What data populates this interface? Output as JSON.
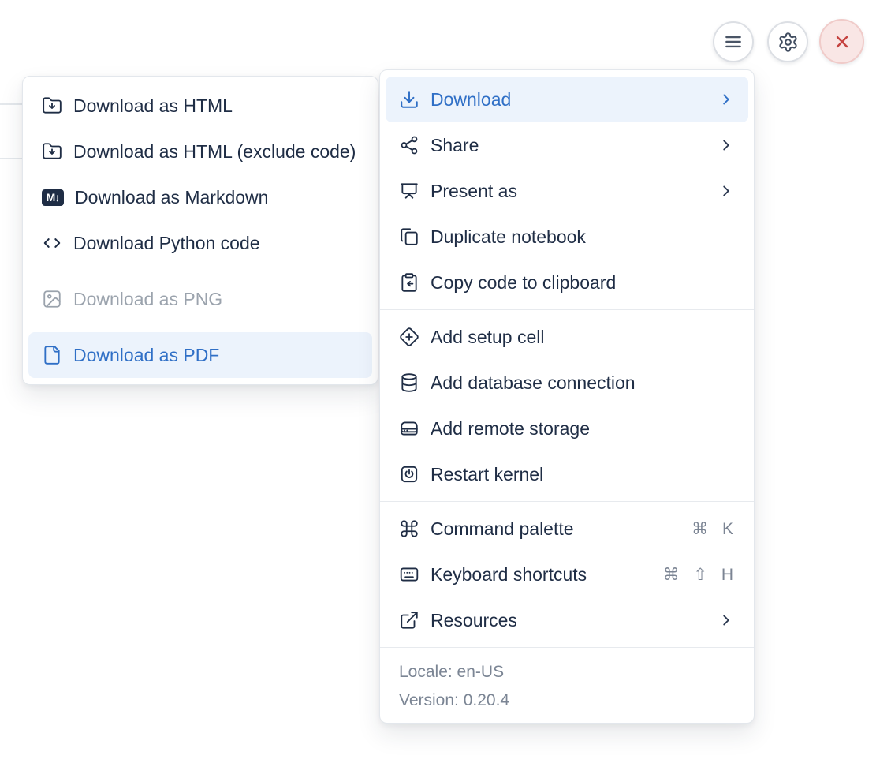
{
  "toolbar": {
    "menu_button": "menu",
    "settings_button": "settings",
    "close_button": "close"
  },
  "download_submenu": {
    "markdown_badge_text": "M↓",
    "items": [
      {
        "label": "Download as HTML",
        "icon": "folder-download-icon",
        "state": "normal"
      },
      {
        "label": "Download as HTML (exclude code)",
        "icon": "folder-download-icon",
        "state": "normal"
      },
      {
        "label": "Download as Markdown",
        "icon": "markdown-icon",
        "state": "normal"
      },
      {
        "label": "Download Python code",
        "icon": "code-icon",
        "state": "normal"
      },
      {
        "label": "Download as PNG",
        "icon": "image-icon",
        "state": "disabled"
      },
      {
        "label": "Download as PDF",
        "icon": "file-icon",
        "state": "highlighted"
      }
    ]
  },
  "main_menu": {
    "groups": [
      {
        "items": [
          {
            "label": "Download",
            "icon": "download-icon",
            "has_submenu": true,
            "state": "highlighted"
          },
          {
            "label": "Share",
            "icon": "share-icon",
            "has_submenu": true
          },
          {
            "label": "Present as",
            "icon": "presentation-icon",
            "has_submenu": true
          },
          {
            "label": "Duplicate notebook",
            "icon": "copy-icon"
          },
          {
            "label": "Copy code to clipboard",
            "icon": "clipboard-icon"
          }
        ]
      },
      {
        "items": [
          {
            "label": "Add setup cell",
            "icon": "diamond-plus-icon"
          },
          {
            "label": "Add database connection",
            "icon": "database-icon"
          },
          {
            "label": "Add remote storage",
            "icon": "storage-icon"
          },
          {
            "label": "Restart kernel",
            "icon": "power-icon"
          }
        ]
      },
      {
        "items": [
          {
            "label": "Command palette",
            "icon": "command-icon",
            "shortcut": "⌘ K"
          },
          {
            "label": "Keyboard shortcuts",
            "icon": "keyboard-icon",
            "shortcut": "⌘ ⇧ H"
          },
          {
            "label": "Resources",
            "icon": "external-link-icon",
            "has_submenu": true
          }
        ]
      }
    ],
    "footer": {
      "locale": "Locale: en-US",
      "version": "Version: 0.20.4"
    }
  },
  "colors": {
    "accent_blue": "#2f6fc6",
    "highlight_bg": "#ecf3fc",
    "text": "#1f2d45",
    "muted": "#7b8594",
    "disabled": "#9ba3ad",
    "danger": "#c5423f",
    "danger_bg": "#f9e6e5"
  }
}
